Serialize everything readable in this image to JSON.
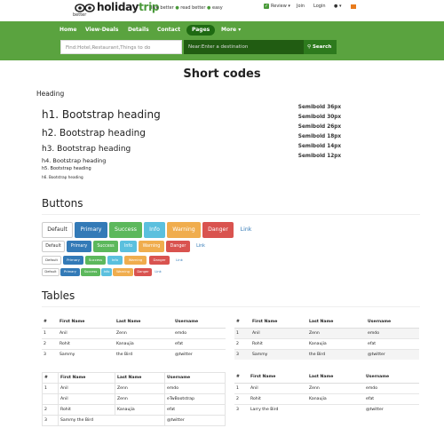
{
  "colors": {
    "green": "#5aa33f",
    "dark_green": "#1e6a12",
    "primary": "#337ab7",
    "success": "#5cb85c",
    "info": "#5bc0de",
    "warning": "#f0ad4e",
    "danger": "#d9534f"
  },
  "header": {
    "logo_holiday": "holiday",
    "logo_trip": "trip",
    "logo_sub": "better",
    "tagline_1": "live better",
    "tagline_2": "read better",
    "tagline_3": "easy",
    "review": "Review",
    "join": "Join",
    "login": "Login"
  },
  "nav": {
    "items": [
      "Home",
      "View-Deals",
      "Details",
      "Contact",
      "Pages",
      "More"
    ],
    "search_placeholder": "Find:Hotel,Restaurant,Things to do",
    "near_placeholder": "Near:Enter a destination",
    "search_button": "Search"
  },
  "short": {
    "title": "Short codes",
    "heading_label": "Heading",
    "headings": [
      "h1. Bootstrap heading",
      "h2. Bootstrap heading",
      "h3. Bootstrap heading",
      "h4. Bootstrap heading",
      "h5. Bootstrap heading",
      "h6. Bootstrap heading"
    ],
    "semibold": [
      "Semibold 36px",
      "Semibold 30px",
      "Semibold 26px",
      "Semibold 18px",
      "Semibold 14px",
      "Semibold 12px"
    ]
  },
  "buttons": {
    "title": "Buttons",
    "labels": [
      "Default",
      "Primary",
      "Success",
      "Info",
      "Warning",
      "Danger",
      "Link"
    ]
  },
  "tables": {
    "title": "Tables",
    "headers": [
      "#",
      "First Name",
      "Last Name",
      "Username"
    ],
    "basic_rows": [
      [
        "1",
        "Anil",
        "Zenn",
        "emdo"
      ],
      [
        "2",
        "Rohit",
        "Kanaujia",
        "efat"
      ],
      [
        "3",
        "Sammy",
        "the Bird",
        "@twitter"
      ]
    ],
    "bordered_rows": [
      [
        "1",
        "Anil",
        "Zenn",
        "emdo"
      ],
      [
        "",
        "Anil",
        "Zenn",
        "eTwBootstrap"
      ],
      [
        "2",
        "Rohit",
        "Kanaujia",
        "efat"
      ],
      [
        "3",
        "Sammy the Bird",
        "",
        "@twitter"
      ]
    ],
    "hover_rows": [
      [
        "1",
        "Anil",
        "Zenn",
        "emdo"
      ],
      [
        "2",
        "Rohit",
        "Kanaujia",
        "efat"
      ],
      [
        "3",
        "Larry the Bird",
        "",
        "@twitter"
      ]
    ]
  }
}
